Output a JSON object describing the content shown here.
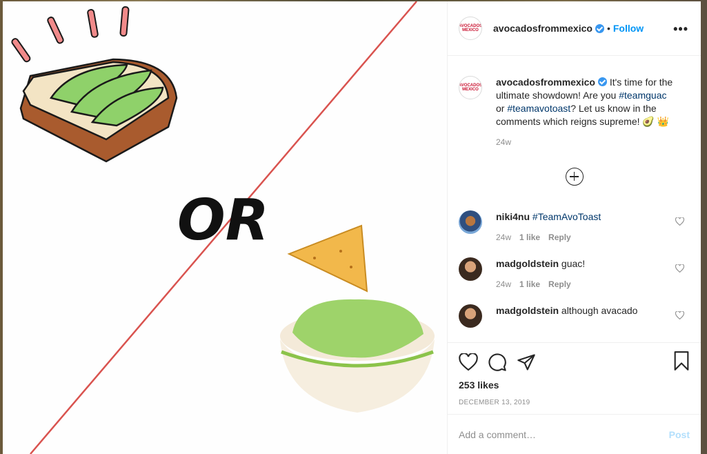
{
  "post": {
    "username": "avocadosfrommexico",
    "follow_label": "Follow",
    "separator": "•",
    "more_label": "•••",
    "logo_text": "AVOCADOS MEXICO",
    "caption_text": "It's time for the ultimate showdown! Are you",
    "caption_tag1": "#teamguac",
    "caption_mid": "or",
    "caption_tag2": "#teamavotoast",
    "caption_end": "? Let us know in the comments which reigns supreme! 🥑 👑",
    "caption_time": "24w",
    "likes": "253 likes",
    "date": "DECEMBER 13, 2019"
  },
  "media": {
    "or_text": "OR",
    "colors": {
      "line": "#d9534f",
      "avocado": "#8fd16a",
      "toast": "#a95b2e",
      "chip": "#f2b84b",
      "guac": "#9ed36a"
    }
  },
  "comments": [
    {
      "user": "niki4nu",
      "text": "#TeamAvoToast",
      "is_tag": true,
      "time": "24w",
      "likes": "1 like",
      "reply": "Reply"
    },
    {
      "user": "madgoldstein",
      "text": "guac!",
      "is_tag": false,
      "time": "24w",
      "likes": "1 like",
      "reply": "Reply"
    },
    {
      "user": "madgoldstein",
      "text": "although avacado",
      "is_tag": false,
      "time": "",
      "likes": "",
      "reply": ""
    }
  ],
  "add_comment": {
    "placeholder": "Add a comment…",
    "post_label": "Post"
  }
}
